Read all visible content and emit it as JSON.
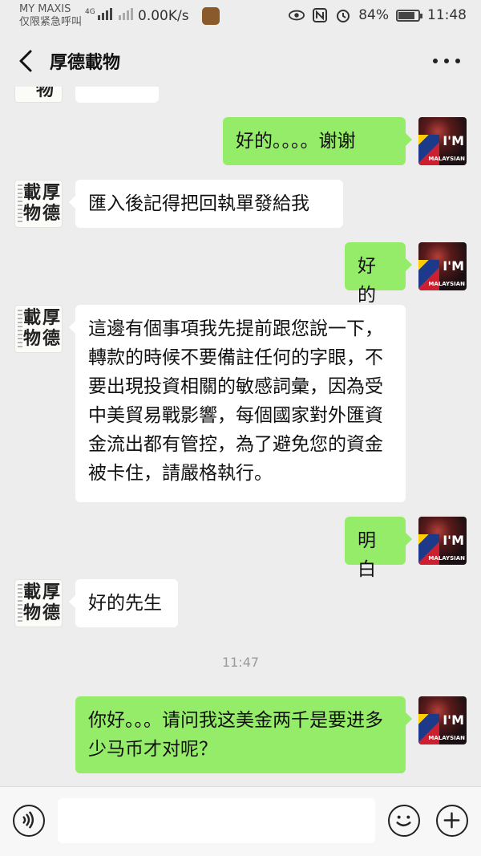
{
  "status_bar": {
    "carrier": "MY MAXIS",
    "emergency": "仅限紧急呼叫",
    "network": "4G",
    "speed": "0.00K/s",
    "battery": "84%",
    "battery_level": 0.84,
    "time": "11:48"
  },
  "nav": {
    "title": "厚德載物"
  },
  "avatars": {
    "contact_chars": [
      "載",
      "厚",
      "物",
      "德"
    ],
    "user_badge": "I'M",
    "user_badge_sub": "MALAYSIAN"
  },
  "messages": [
    {
      "side": "out",
      "text": "好的。。。。谢谢"
    },
    {
      "side": "in",
      "text": "匯入後記得把回執單發給我"
    },
    {
      "side": "out",
      "text": "好的"
    },
    {
      "side": "in",
      "text": "這邊有個事項我先提前跟您說一下，轉款的時候不要備註任何的字眼，不要出現投資相關的敏感詞彙，因為受中美貿易戰影響，每個國家對外匯資金流出都有管控，為了避免您的資金被卡住，請嚴格執行。"
    },
    {
      "side": "out",
      "text": "明白"
    },
    {
      "side": "in",
      "text": "好的先生"
    },
    {
      "side": "out",
      "text": "你好。。。请问我这美金两千是要进多少马币才对呢？"
    }
  ],
  "timestamp": "11:47",
  "input": {
    "placeholder": ""
  },
  "colors": {
    "background": "#ededed",
    "incoming_bubble": "#ffffff",
    "outgoing_bubble": "#95ec69"
  }
}
